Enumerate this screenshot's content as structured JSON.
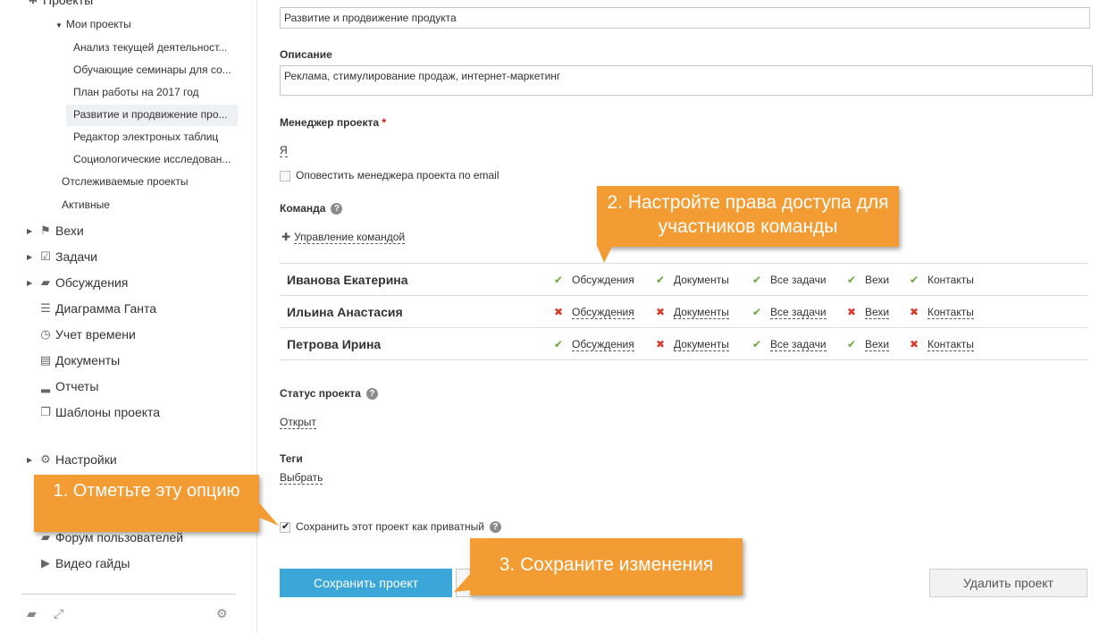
{
  "sidebar": {
    "top_partial": "Проекты",
    "my_projects": "Мои проекты",
    "projects": [
      "Анализ текущей деятельност...",
      "Обучающие семинары для со...",
      "План работы на 2017 год",
      "Развитие и продвижение про...",
      "Редактор электроных таблиц",
      "Социологические исследован..."
    ],
    "followed": "Отслеживаемые проекты",
    "active": "Активные",
    "nav": [
      {
        "label": "Вехи",
        "icon": "flag-icon"
      },
      {
        "label": "Задачи",
        "icon": "checkbox-icon"
      },
      {
        "label": "Обсуждения",
        "icon": "comment-icon"
      },
      {
        "label": "Диаграмма Ганта",
        "icon": "gantt-icon"
      },
      {
        "label": "Учет времени",
        "icon": "clock-icon"
      },
      {
        "label": "Документы",
        "icon": "document-icon"
      },
      {
        "label": "Отчеты",
        "icon": "bar-chart-icon"
      },
      {
        "label": "Шаблоны проекта",
        "icon": "template-icon"
      }
    ],
    "settings": "Настройки",
    "forum": "Форум пользователей",
    "video": "Видео гайды"
  },
  "form": {
    "title_value": "Развитие и продвижение продукта",
    "description_label": "Описание",
    "description_value": "Реклама, стимулирование продаж, интернет-маркетинг",
    "manager_label": "Менеджер проекта",
    "required_mark": "*",
    "manager_value": "Я",
    "notify_label": "Оповестить менеджера проекта по email",
    "team_label": "Команда",
    "team_manage": "Управление командой",
    "team": [
      {
        "name": "Иванова Екатерина",
        "perms": [
          {
            "label": "Обсуждения",
            "allowed": true
          },
          {
            "label": "Документы",
            "allowed": true
          },
          {
            "label": "Все задачи",
            "allowed": true
          },
          {
            "label": "Вехи",
            "allowed": true
          },
          {
            "label": "Контакты",
            "allowed": true
          }
        ]
      },
      {
        "name": "Ильина Анастасия",
        "perms": [
          {
            "label": "Обсуждения",
            "allowed": false
          },
          {
            "label": "Документы",
            "allowed": false
          },
          {
            "label": "Все задачи",
            "allowed": true
          },
          {
            "label": "Вехи",
            "allowed": false
          },
          {
            "label": "Контакты",
            "allowed": false
          }
        ]
      },
      {
        "name": "Петрова Ирина",
        "perms": [
          {
            "label": "Обсуждения",
            "allowed": true
          },
          {
            "label": "Документы",
            "allowed": false
          },
          {
            "label": "Все задачи",
            "allowed": true
          },
          {
            "label": "Вехи",
            "allowed": true
          },
          {
            "label": "Контакты",
            "allowed": false
          }
        ]
      }
    ],
    "status_label": "Статус проекта",
    "status_value": "Открыт",
    "tags_label": "Теги",
    "tags_value": "Выбрать",
    "private_label": "Сохранить этот проект как приватный",
    "save_button": "Сохранить проект",
    "delete_button": "Удалить проект"
  },
  "callouts": {
    "one": "1. Отметьте эту опцию",
    "two": "2. Настройте права доступа для участников команды",
    "three": "3. Сохраните изменения"
  },
  "colors": {
    "callout": "#f39c33",
    "primary": "#3ba7d8",
    "allowed": "#6ba43a",
    "denied": "#d93a2b"
  }
}
